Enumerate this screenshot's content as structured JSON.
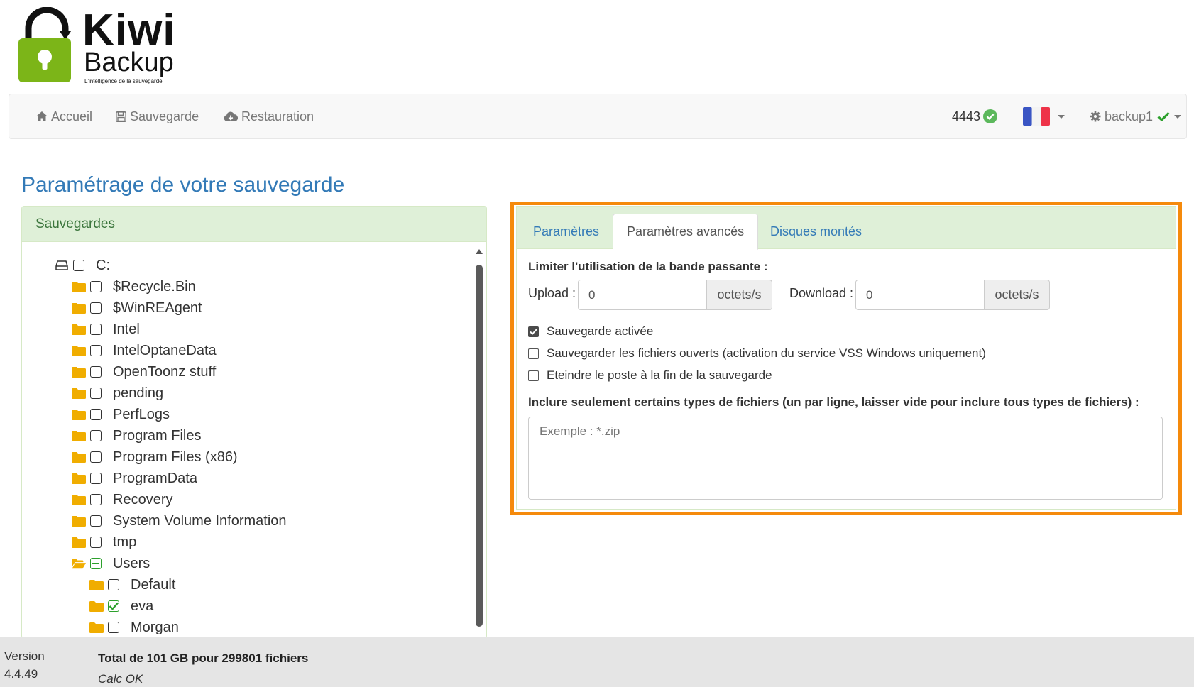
{
  "logo": {
    "name": "Kiwi",
    "subname": "Backup",
    "tagline": "L'intelligence de la sauvegarde",
    "color": "#7cb518"
  },
  "nav": {
    "accueil": "Accueil",
    "sauvegarde": "Sauvegarde",
    "restauration": "Restauration",
    "count": "4443",
    "language": "fr",
    "user": "backup1"
  },
  "page_title": "Paramétrage de votre sauvegarde",
  "left_panel": {
    "heading": "Sauvegardes",
    "drive": "C:",
    "folders": [
      "$Recycle.Bin",
      "$WinREAgent",
      "Intel",
      "IntelOptaneData",
      "OpenToonz stuff",
      "pending",
      "PerfLogs",
      "Program Files",
      "Program Files (x86)",
      "ProgramData",
      "Recovery",
      "System Volume Information",
      "tmp"
    ],
    "users_folder": "Users",
    "users_children": [
      {
        "name": "Default",
        "checked": false
      },
      {
        "name": "eva",
        "checked": true
      },
      {
        "name": "Morgan",
        "checked": false
      }
    ]
  },
  "right_panel": {
    "tabs": [
      "Paramètres",
      "Paramètres avancés",
      "Disques montés"
    ],
    "active_tab": 1,
    "bandwidth_label": "Limiter l'utilisation de la bande passante :",
    "upload_label": "Upload :",
    "upload_value": "0",
    "download_label": "Download :",
    "download_value": "0",
    "unit": "octets/s",
    "options": [
      {
        "label": "Sauvegarde activée",
        "checked": true
      },
      {
        "label": "Sauvegarder les fichiers ouverts (activation du service VSS Windows uniquement)",
        "checked": false
      },
      {
        "label": "Eteindre le poste à la fin de la sauvegarde",
        "checked": false
      }
    ],
    "include_label": "Inclure seulement certains types de fichiers (un par ligne, laisser vide pour inclure tous types de fichiers) :",
    "include_placeholder": "Exemple : *.zip",
    "include_value": ""
  },
  "footer": {
    "version_label": "Version",
    "version": "4.4.49",
    "total": "Total de 101 GB pour 299801 fichiers",
    "calc": "Calc OK"
  },
  "colors": {
    "accent": "#337ab7",
    "highlight": "#f58a0c",
    "success": "#5cb85c",
    "folder": "#f0ad00"
  }
}
